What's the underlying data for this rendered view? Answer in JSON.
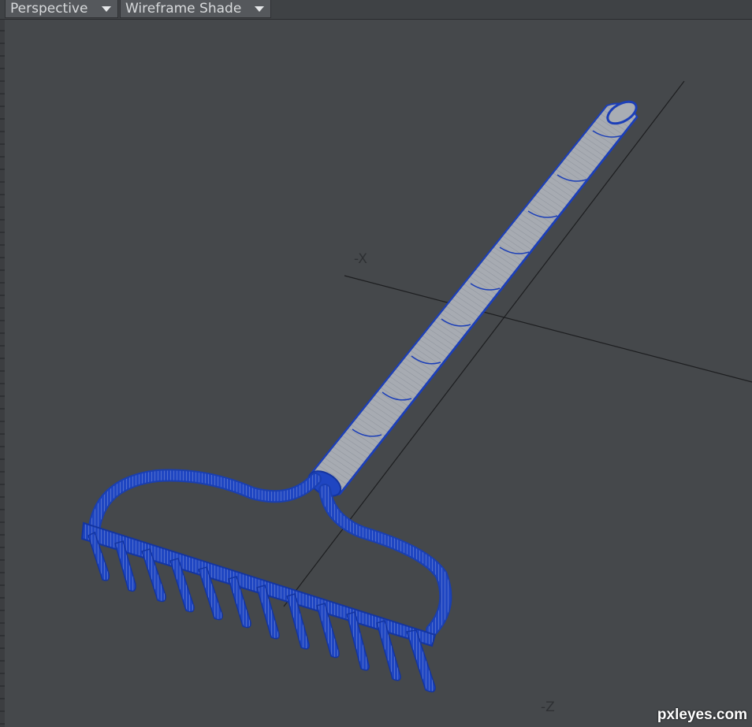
{
  "toolbar": {
    "view_mode": "Perspective",
    "shading_mode": "Wireframe Shade"
  },
  "viewport": {
    "axis_x_label": "-X",
    "axis_z_label": "-Z",
    "object": "rake",
    "wire_color": "#1a3fb0",
    "surface_color": "#a9adb4",
    "background_color": "#45484b",
    "axis_color": "#1f2022"
  },
  "watermark": "pxleyes.com"
}
